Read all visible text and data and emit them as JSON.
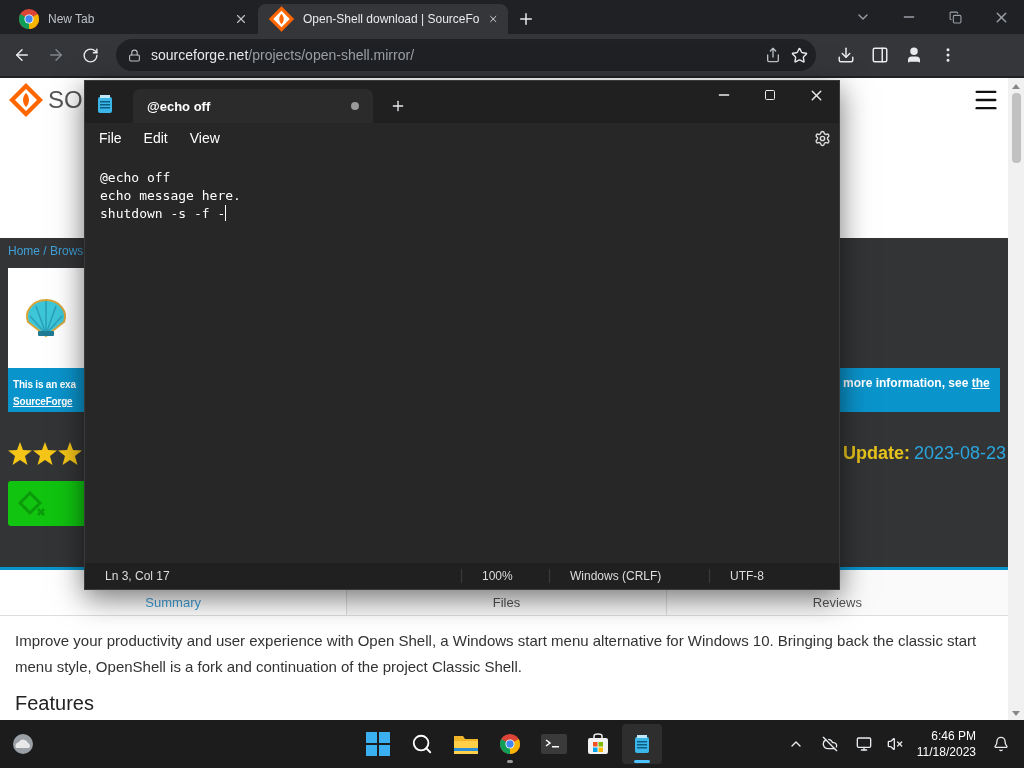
{
  "browser": {
    "tabs": [
      {
        "title": "New Tab",
        "kind": "newtab",
        "selected": false
      },
      {
        "title": "Open-Shell download | SourceFo",
        "kind": "site",
        "selected": true
      }
    ],
    "address": {
      "host": "sourceforge.net",
      "path": "/projects/open-shell.mirror/"
    }
  },
  "page": {
    "logo_text": "SO",
    "breadcrumb": "Home / Brows",
    "notice": {
      "left_text": "This is an exa",
      "left_link": "SourceForge",
      "right_text": "more information, see ",
      "right_link": "the"
    },
    "rating": {
      "stars": 3
    },
    "update": {
      "label": "Update:",
      "date": "2023-08-23"
    },
    "tabs": [
      {
        "label": "Summary",
        "selected": true
      },
      {
        "label": "Files",
        "selected": false
      },
      {
        "label": "Reviews",
        "selected": false
      }
    ],
    "description": "Improve your productivity and user experience with Open Shell, a Windows start menu alternative for Windows 10. Bringing back the classic start menu style, OpenShell is a fork and continuation of the project Classic Shell.",
    "heading": "Features"
  },
  "notepad": {
    "tab_title": "@echo off",
    "unsaved": true,
    "menu": [
      "File",
      "Edit",
      "View"
    ],
    "lines": [
      "@echo off",
      "echo message here.",
      "shutdown -s -f -"
    ],
    "status": {
      "position": "Ln 3, Col 17",
      "zoom": "100%",
      "line_ending": "Windows (CRLF)",
      "encoding": "UTF-8"
    }
  },
  "taskbar": {
    "apps": [
      {
        "kind": "start",
        "open": false,
        "selected": false
      },
      {
        "kind": "search",
        "open": false,
        "selected": false
      },
      {
        "kind": "folder",
        "open": false,
        "selected": false
      },
      {
        "kind": "chrome",
        "open": true,
        "selected": false
      },
      {
        "kind": "terminal",
        "open": false,
        "selected": false
      },
      {
        "kind": "store",
        "open": false,
        "selected": false
      },
      {
        "kind": "notepad",
        "open": true,
        "selected": true
      }
    ],
    "time": "6:46 PM",
    "date": "11/18/2023"
  }
}
